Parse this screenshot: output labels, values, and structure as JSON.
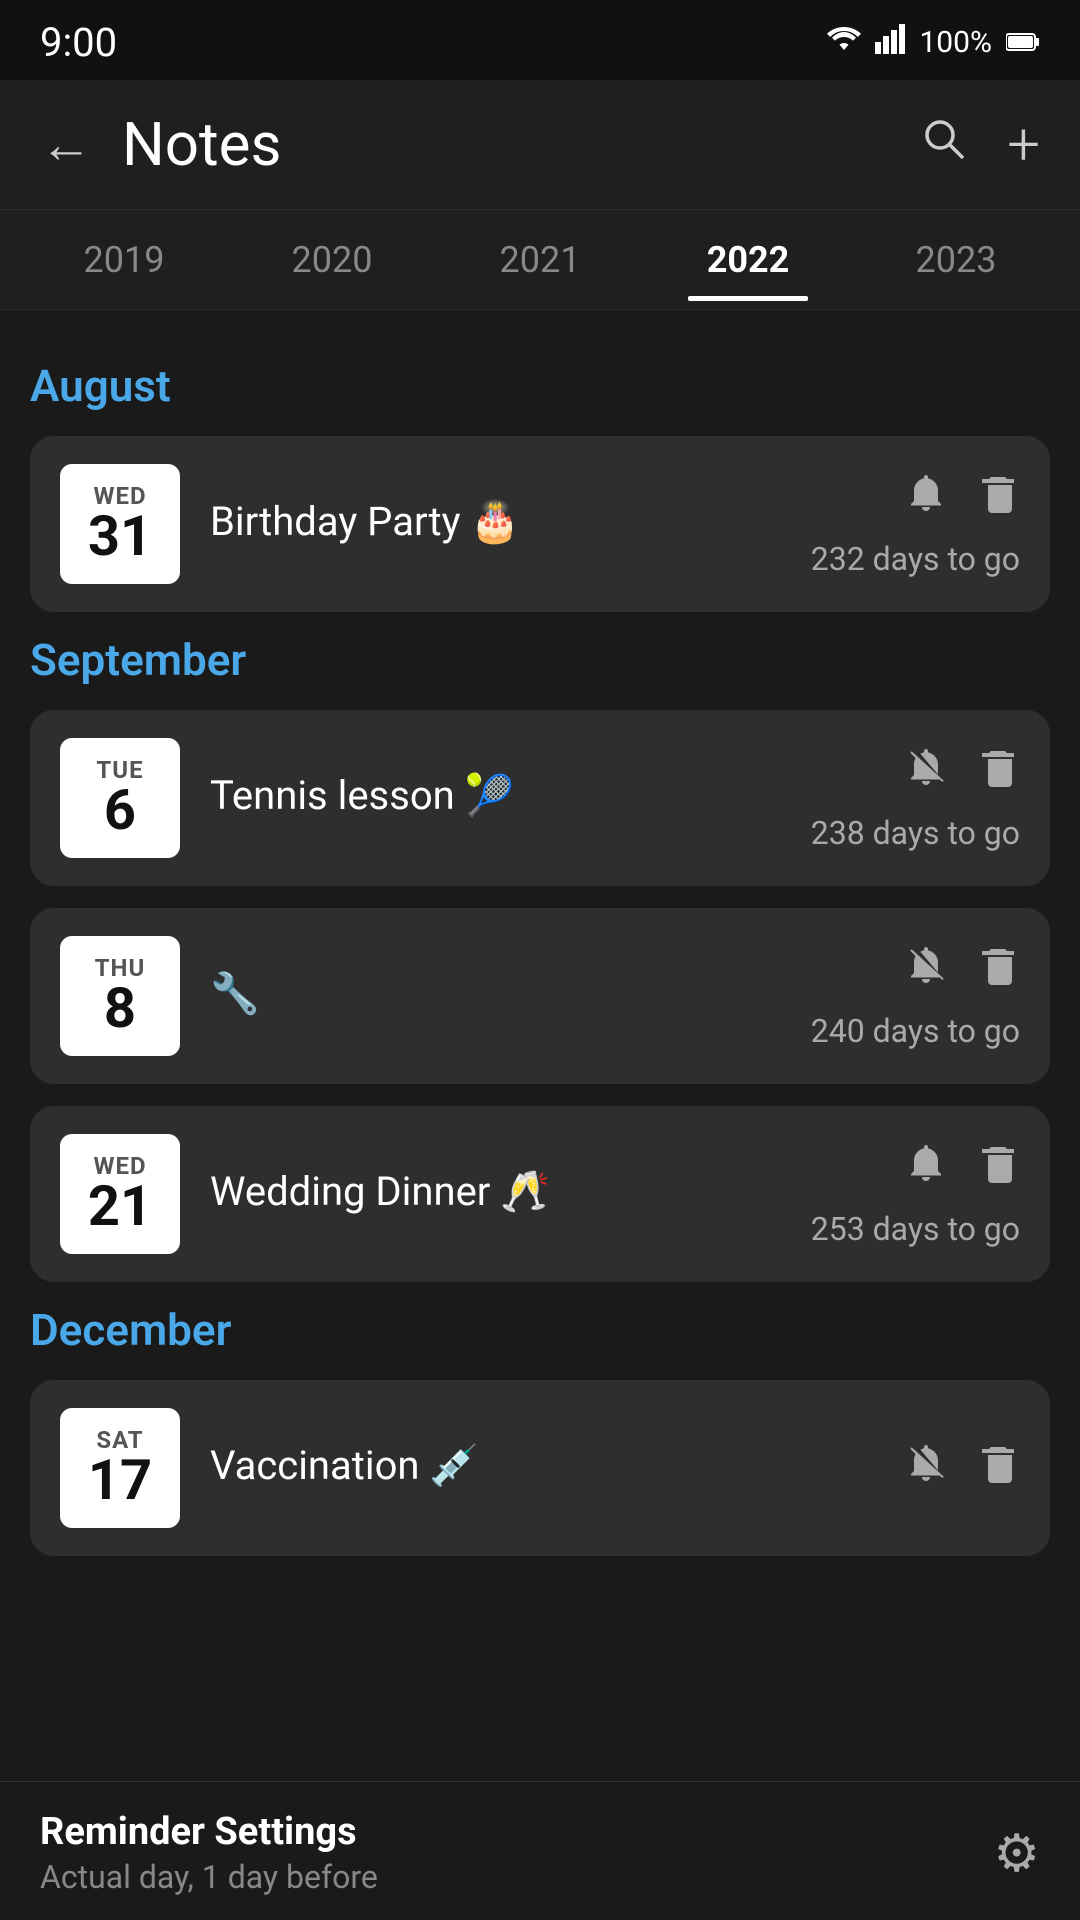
{
  "statusBar": {
    "time": "9:00",
    "battery": "100%"
  },
  "header": {
    "backLabel": "←",
    "title": "Notes",
    "searchIcon": "search",
    "addIcon": "+"
  },
  "yearTabs": [
    {
      "label": "2019",
      "active": false
    },
    {
      "label": "2020",
      "active": false
    },
    {
      "label": "2021",
      "active": false
    },
    {
      "label": "2022",
      "active": true
    },
    {
      "label": "2023",
      "active": false
    }
  ],
  "sections": [
    {
      "month": "August",
      "events": [
        {
          "dayName": "WED",
          "dayNum": "31",
          "title": "Birthday Party 🎂",
          "bellActive": true,
          "daysToGo": "232 days to go"
        }
      ]
    },
    {
      "month": "September",
      "events": [
        {
          "dayName": "TUE",
          "dayNum": "6",
          "title": "Tennis lesson 🎾",
          "bellActive": false,
          "daysToGo": "238 days to go"
        },
        {
          "dayName": "THU",
          "dayNum": "8",
          "title": "🔧",
          "bellActive": false,
          "daysToGo": "240 days to go"
        },
        {
          "dayName": "WED",
          "dayNum": "21",
          "title": "Wedding Dinner 🥂",
          "bellActive": true,
          "daysToGo": "253 days to go"
        }
      ]
    },
    {
      "month": "December",
      "events": [
        {
          "dayName": "SAT",
          "dayNum": "17",
          "title": "Vaccination 💉",
          "bellActive": false,
          "daysToGo": ""
        }
      ]
    }
  ],
  "bottomBar": {
    "title": "Reminder Settings",
    "subtitle": "Actual day, 1 day before",
    "settingsIcon": "⚙"
  }
}
